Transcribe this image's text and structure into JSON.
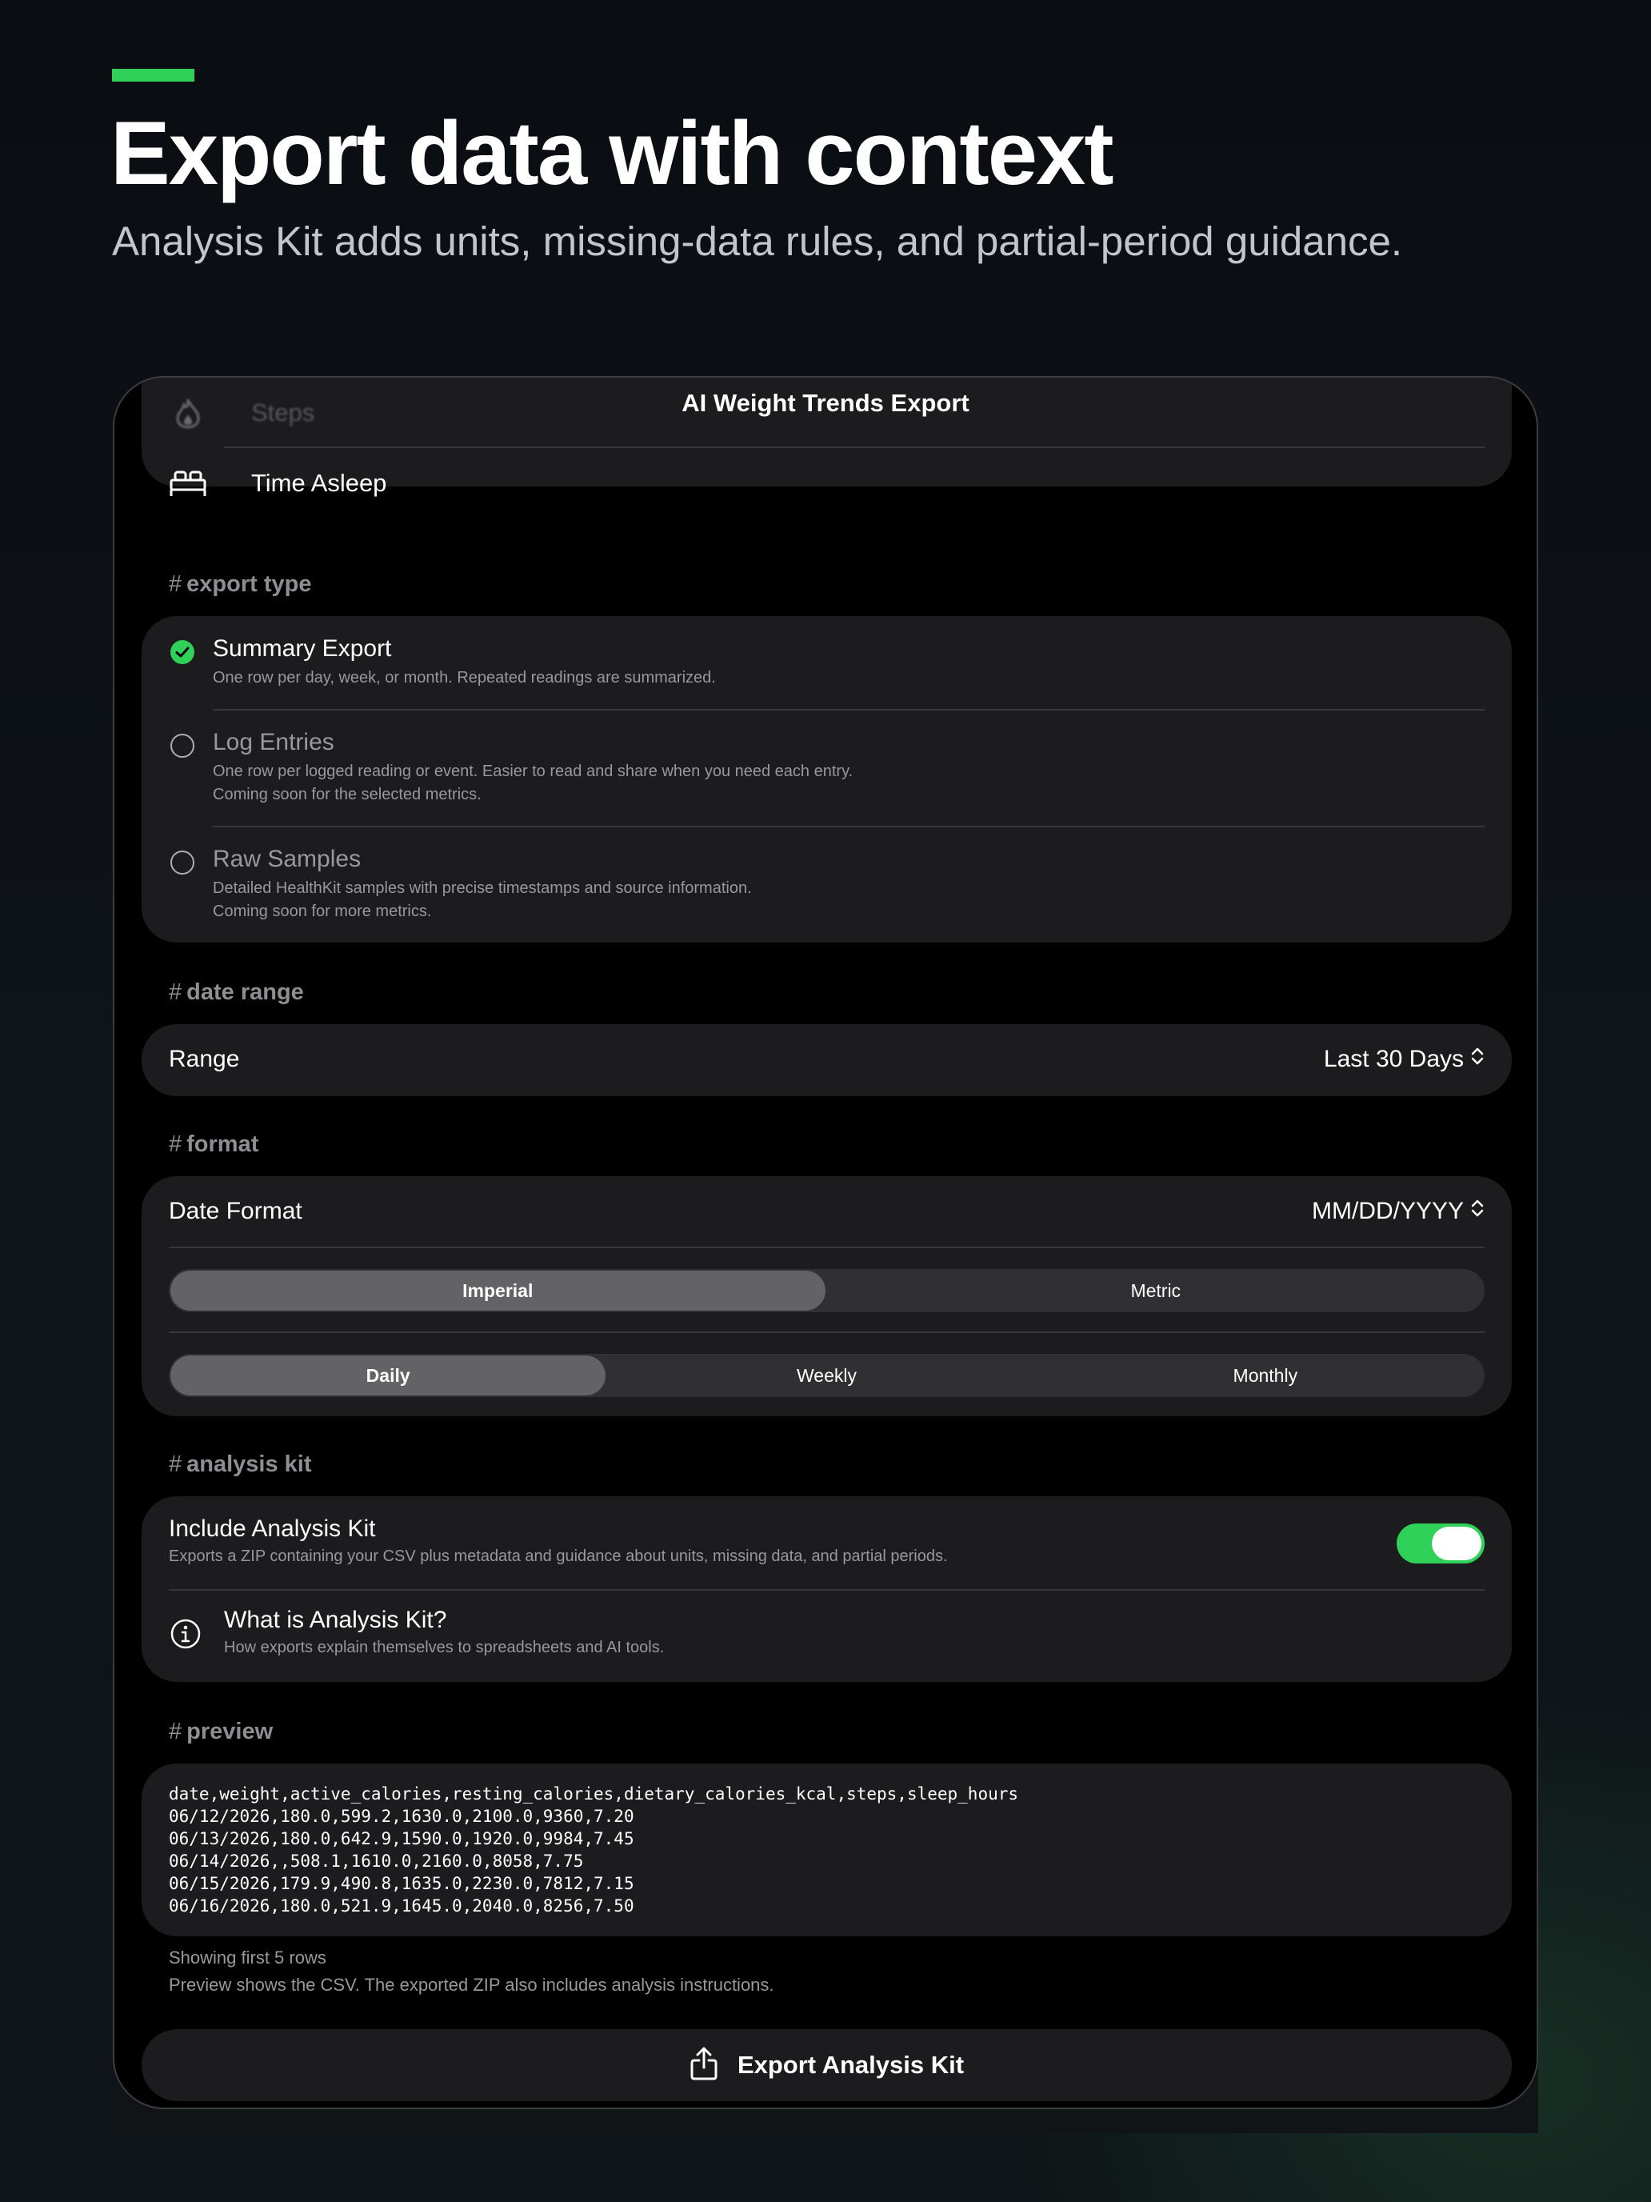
{
  "hero": {
    "title": "Export data with context",
    "subtitle": "Analysis Kit adds units, missing-data rules, and partial-period guidance."
  },
  "app": {
    "nav_title": "AI Weight Trends Export"
  },
  "metrics": {
    "items": [
      {
        "label": "Steps",
        "icon": "flame-icon"
      },
      {
        "label": "Time Asleep",
        "icon": "bed-icon"
      }
    ]
  },
  "export_type": {
    "header": "export type",
    "options": [
      {
        "title": "Summary Export",
        "desc": [
          "One row per day, week, or month. Repeated readings are summarized."
        ],
        "selected": true
      },
      {
        "title": "Log Entries",
        "desc": [
          "One row per logged reading or event. Easier to read and share when you need each entry.",
          "Coming soon for the selected metrics."
        ],
        "selected": false
      },
      {
        "title": "Raw Samples",
        "desc": [
          "Detailed HealthKit samples with precise timestamps and source information.",
          "Coming soon for more metrics."
        ],
        "selected": false
      }
    ]
  },
  "date_range": {
    "header": "date range",
    "label": "Range",
    "value": "Last 30 Days"
  },
  "format": {
    "header": "format",
    "date_format_label": "Date Format",
    "date_format_value": "MM/DD/YYYY",
    "units": [
      "Imperial",
      "Metric"
    ],
    "units_selected": "Imperial",
    "period": [
      "Daily",
      "Weekly",
      "Monthly"
    ],
    "period_selected": "Daily"
  },
  "analysis_kit": {
    "header": "analysis kit",
    "include_title": "Include Analysis Kit",
    "include_desc": "Exports a ZIP containing your CSV plus metadata and guidance about units, missing data, and partial periods.",
    "include_on": true,
    "info_title": "What is Analysis Kit?",
    "info_desc": "How exports explain themselves to spreadsheets and AI tools."
  },
  "preview": {
    "header": "preview",
    "lines": [
      "date,weight,active_calories,resting_calories,dietary_calories_kcal,steps,sleep_hours",
      "06/12/2026,180.0,599.2,1630.0,2100.0,9360,7.20",
      "06/13/2026,180.0,642.9,1590.0,1920.0,9984,7.45",
      "06/14/2026,,508.1,1610.0,2160.0,8058,7.75",
      "06/15/2026,179.9,490.8,1635.0,2230.0,7812,7.15",
      "06/16/2026,180.0,521.9,1645.0,2040.0,8256,7.50"
    ],
    "note_rows": "Showing first 5 rows",
    "note_zip": "Preview shows the CSV. The exported ZIP also includes analysis instructions."
  },
  "export_button": {
    "label": "Export Analysis Kit",
    "icon": "share-icon"
  },
  "colors": {
    "accent": "#30d158",
    "card": "#1c1c1e",
    "background": "#000000"
  }
}
